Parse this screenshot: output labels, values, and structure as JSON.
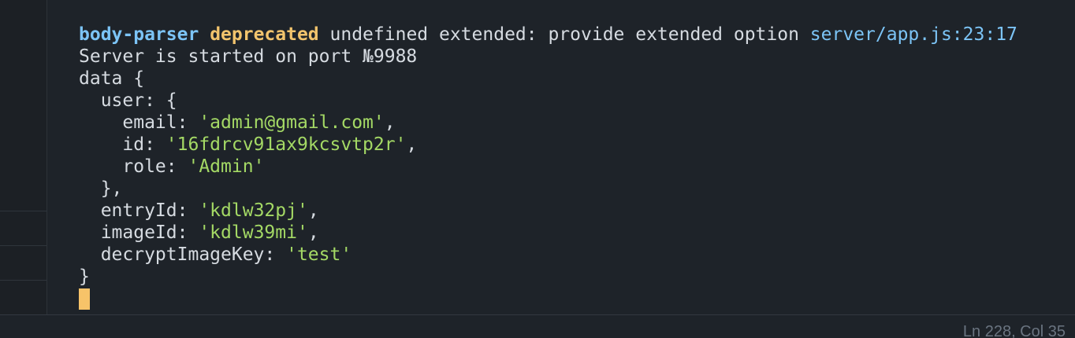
{
  "terminal": {
    "top_fragment": "      ",
    "deprecation": {
      "module": "body-parser",
      "level": "deprecated",
      "message": " undefined extended: provide extended option ",
      "location": "server/app.js:23:17"
    },
    "server_line": "Server is started on port №9988",
    "data_open": "data {",
    "user_open": "  user: {",
    "email_key": "    email: ",
    "email_val": "'admin@gmail.com'",
    "id_key": "    id: ",
    "id_val": "'16fdrcv91ax9kcsvtp2r'",
    "role_key": "    role: ",
    "role_val": "'Admin'",
    "user_close": "  },",
    "entry_key": "  entryId: ",
    "entry_val": "'kdlw32pj'",
    "image_key": "  imageId: ",
    "image_val": "'kdlw39mi'",
    "decrypt_key": "  decryptImageKey: ",
    "decrypt_val": "'test'",
    "data_close": "}",
    "comma": ","
  },
  "status_bar": {
    "position": "Ln 228, Col 35"
  },
  "colors": {
    "background": "#1e2329",
    "keyword_blue": "#7cc4f6",
    "keyword_yellow": "#f2c46d",
    "string_green": "#a4d965",
    "cursor": "#f7c369"
  }
}
